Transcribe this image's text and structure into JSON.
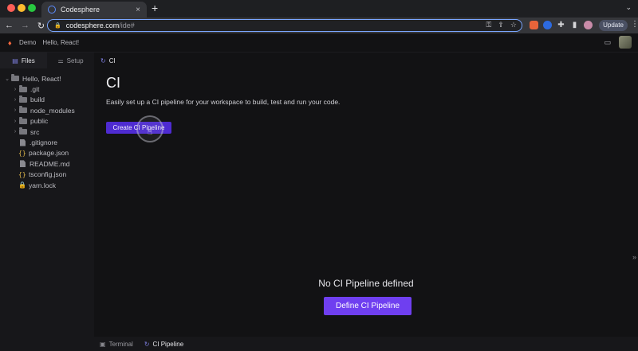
{
  "browser": {
    "tab_title": "Codesphere",
    "url_host": "codesphere.com",
    "url_path": "/ide#",
    "update_label": "Update",
    "new_tab_glyph": "+",
    "close_glyph": "×"
  },
  "header": {
    "crumbs": [
      "Demo",
      "Hello, React!"
    ]
  },
  "sidebar": {
    "tabs": [
      {
        "label": "Files",
        "icon": "file-icon"
      },
      {
        "label": "Setup",
        "icon": "sliders-icon"
      }
    ],
    "tree": [
      {
        "name": "Hello, React!",
        "type": "folder",
        "expanded": true
      },
      {
        "name": ".git",
        "type": "folder"
      },
      {
        "name": "build",
        "type": "folder"
      },
      {
        "name": "node_modules",
        "type": "folder"
      },
      {
        "name": "public",
        "type": "folder"
      },
      {
        "name": "src",
        "type": "folder"
      },
      {
        "name": ".gitignore",
        "type": "file"
      },
      {
        "name": "package.json",
        "type": "json"
      },
      {
        "name": "README.md",
        "type": "file"
      },
      {
        "name": "tsconfig.json",
        "type": "json"
      },
      {
        "name": "yarn.lock",
        "type": "lock"
      }
    ]
  },
  "main": {
    "tab_label": "CI",
    "title": "CI",
    "description": "Easily set up a CI pipeline for your workspace to build, test and run your code.",
    "create_button": "Create CI Pipeline",
    "empty_title": "No CI Pipeline defined",
    "define_button": "Define CI Pipeline"
  },
  "bottom": {
    "tabs": [
      {
        "label": "Terminal",
        "active": false
      },
      {
        "label": "CI Pipeline",
        "active": true
      }
    ]
  },
  "colors": {
    "accent": "#6f3ff0",
    "accent_dark": "#4e2bd1",
    "brand": "#ff6a3d"
  }
}
